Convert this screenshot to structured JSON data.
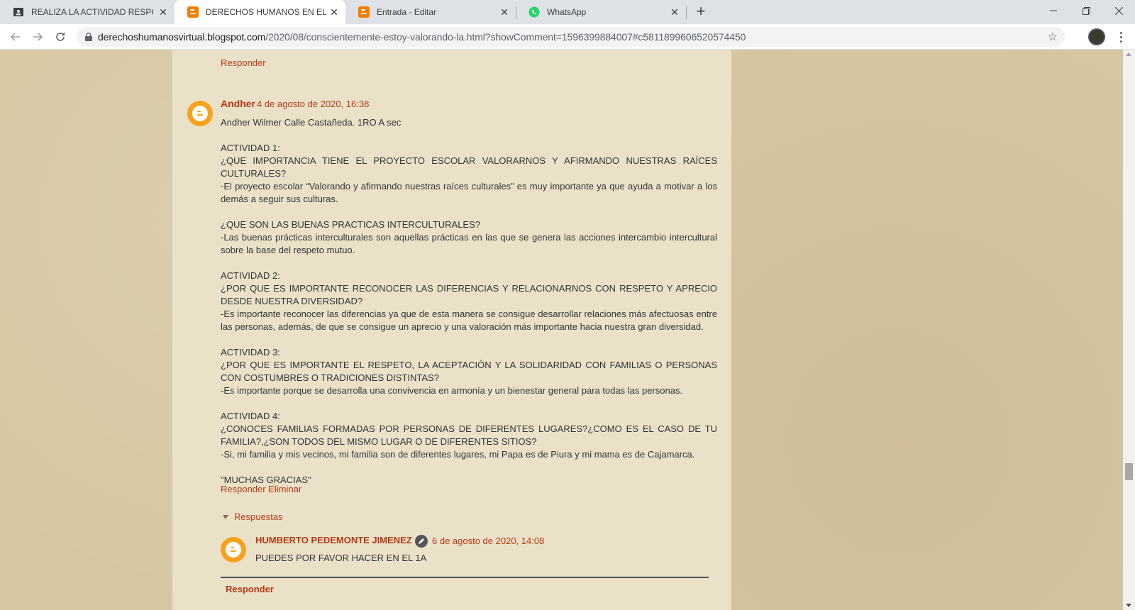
{
  "browser": {
    "tabs": [
      {
        "title": "REALIZA LA ACTIVIDAD RESPONDIENDO",
        "icon": "classroom-icon",
        "active": false
      },
      {
        "title": "DERECHOS HUMANOS EN EL MUNDO",
        "icon": "blogger-icon",
        "active": true
      },
      {
        "title": "Entrada - Editar",
        "icon": "blogger-icon",
        "active": false
      },
      {
        "title": "WhatsApp",
        "icon": "whatsapp-icon",
        "active": false
      }
    ],
    "url_host": "derechoshumanosvirtual.blogspot.com",
    "url_path": "/2020/08/conscientemente-estoy-valorando-la.html?showComment=1596399884007#c5811899606520574450"
  },
  "page": {
    "reply_top": "Responder",
    "comment": {
      "author": "Andher",
      "date": "4 de agosto de 2020, 16:38",
      "body": [
        "Andher Wilmer Calle Castañeda. 1RO A sec",
        "",
        "ACTIVIDAD 1:",
        "¿QUE IMPORTANCIA TIENE EL PROYECTO ESCOLAR VALORARNOS Y AFIRMANDO NUESTRAS RAÍCES CULTURALES?",
        "-El proyecto escolar “Valorando y afirmando nuestras raíces culturales” es muy importante ya que ayuda a motivar a los demás a seguir sus culturas.",
        "",
        "¿QUE SON LAS BUENAS PRACTICAS INTERCULTURALES?",
        "-Las buenas prácticas interculturales son aquellas prácticas en las que se genera las acciones intercambio intercultural sobre la base del respeto mutuo.",
        "",
        "ACTIVIDAD 2:",
        "¿POR QUE ES IMPORTANTE RECONOCER LAS DIFERENCIAS Y RELACIONARNOS CON RESPETO Y APRECIO DESDE NUESTRA DIVERSIDAD?",
        "-Es importante reconocer las diferencias ya que de esta manera se consigue desarrollar relaciones más afectuosas entre las personas, además, de que se consigue un aprecio y una valoración más importante hacia nuestra gran diversidad.",
        "",
        "ACTIVIDAD 3:",
        "¿POR QUE ES IMPORTANTE EL RESPETO, LA ACEPTACIÓN Y LA SOLIDARIDAD CON FAMILIAS O PERSONAS CON COSTUMBRES O TRADICIONES DISTINTAS?",
        "-Es importante porque se desarrolla una convivencia en armonía y un bienestar general para todas las personas.",
        "",
        "ACTIVIDAD 4:",
        "¿CONOCES FAMILIAS FORMADAS POR PERSONAS DE DIFERENTES LUGARES?¿COMO ES EL CASO DE TU FAMILIA?,¿SON TODOS DEL MISMO LUGAR O DE DIFERENTES SITIOS?",
        "-Si, mi familia y mis vecinos, mi familia son de diferentes lugares, mi Papa es de Piura y mi mama es de Cajamarca.",
        "",
        "\"MUCHAS GRACIAS\""
      ],
      "reply_label": "Responder",
      "delete_label": "Eliminar"
    },
    "replies_toggle": "Respuestas",
    "reply": {
      "author": "HUMBERTO PEDEMONTE JIMENEZ",
      "date": "6 de agosto de 2020, 14:08",
      "body": "PUEDES POR FAVOR HACER EN EL 1A"
    },
    "reply_bottom": "Responder"
  },
  "colors": {
    "link": "#b23a12",
    "background": "#d6c7a1",
    "post_column": "#ebe1c9",
    "avatar": "#f7a21b"
  }
}
